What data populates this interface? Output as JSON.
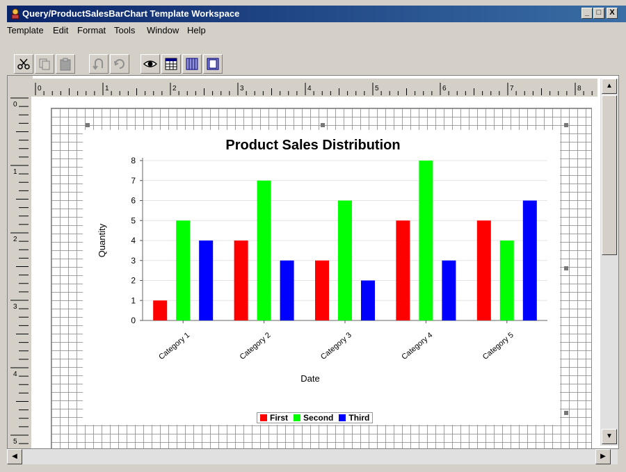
{
  "window": {
    "title": "Query/ProductSalesBarChart Template Workspace",
    "controls": {
      "minimize": "_",
      "maximize": "□",
      "close": "X"
    }
  },
  "menu": [
    "Template",
    "Edit",
    "Format",
    "Tools",
    "Window",
    "Help"
  ],
  "toolbar": {
    "buttons": [
      {
        "name": "cut-button",
        "icon": "scissors-icon"
      },
      {
        "name": "copy-button",
        "icon": "copy-icon"
      },
      {
        "name": "paste-button",
        "icon": "clipboard-icon"
      },
      {
        "name": "undo-button",
        "icon": "undo-icon"
      },
      {
        "name": "redo-button",
        "icon": "redo-icon"
      },
      {
        "name": "preview-button",
        "icon": "eye-icon"
      },
      {
        "name": "table-button",
        "icon": "table-icon"
      },
      {
        "name": "columns-button",
        "icon": "columns-icon"
      },
      {
        "name": "page-button",
        "icon": "page-icon"
      }
    ]
  },
  "rulers": {
    "horizontal_labels": [
      "0",
      "1",
      "2",
      "3",
      "4",
      "5",
      "6",
      "7",
      "8"
    ],
    "vertical_labels": [
      "0",
      "1",
      "2",
      "3",
      "4",
      "5"
    ]
  },
  "colors": {
    "titlebar_start": "#0a246a",
    "titlebar_end": "#3a6ea5",
    "series_first": "#ff0000",
    "series_second": "#00ff00",
    "series_third": "#0000ff"
  },
  "chart_data": {
    "type": "bar",
    "title": "Product Sales Distribution",
    "xlabel": "Date",
    "ylabel": "Quantity",
    "categories": [
      "Category 1",
      "Category 2",
      "Category 3",
      "Category 4",
      "Category 5"
    ],
    "series": [
      {
        "name": "First",
        "color": "#ff0000",
        "values": [
          1,
          4,
          3,
          5,
          5
        ]
      },
      {
        "name": "Second",
        "color": "#00ff00",
        "values": [
          5,
          7,
          6,
          8,
          4
        ]
      },
      {
        "name": "Third",
        "color": "#0000ff",
        "values": [
          4,
          3,
          2,
          3,
          6
        ]
      }
    ],
    "ylim": [
      0,
      8
    ],
    "yticks": [
      0,
      1,
      2,
      3,
      4,
      5,
      6,
      7,
      8
    ],
    "grid": true,
    "legend_position": "bottom"
  }
}
